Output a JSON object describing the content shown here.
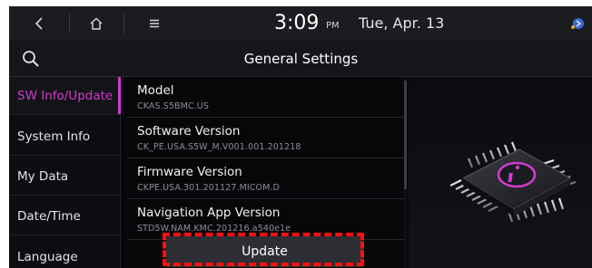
{
  "status_bar": {
    "time": "3:09",
    "ampm": "PM",
    "date": "Tue, Apr. 13"
  },
  "title_bar": {
    "title": "General Settings"
  },
  "sidebar": {
    "items": [
      {
        "label": "SW Info/Update",
        "active": true
      },
      {
        "label": "System Info",
        "active": false
      },
      {
        "label": "My Data",
        "active": false
      },
      {
        "label": "Date/Time",
        "active": false
      },
      {
        "label": "Language",
        "active": false
      }
    ]
  },
  "info_list": [
    {
      "label": "Model",
      "value": "CKAS.S5BMC.US"
    },
    {
      "label": "Software Version",
      "value": "CK_PE.USA.S5W_M.V001.001.201218"
    },
    {
      "label": "Firmware Version",
      "value": "CKPE.USA.301.201127.MICOM.D"
    },
    {
      "label": "Navigation App Version",
      "value": "STD5W.NAM.KMC.201216.a540e1e"
    }
  ],
  "update_button": {
    "label": "Update"
  },
  "colors": {
    "accent": "#d23ad0",
    "highlight": "#ff1010",
    "background": "#060709"
  },
  "icons": {
    "back": "chevron-left-icon",
    "home": "home-icon",
    "menu": "hamburger-menu-icon",
    "search": "search-icon",
    "status": "phone-status-icon",
    "info_chip": "info-chip-icon"
  }
}
